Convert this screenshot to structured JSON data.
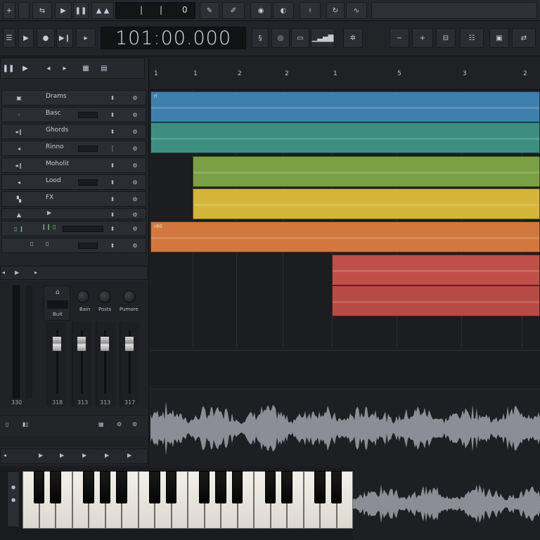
{
  "top_toolbar": {
    "position_marks": [
      "|",
      "|",
      "0"
    ],
    "icons": [
      "add-track-icon",
      "select-tool-icon",
      "play-icon",
      "pause-icon",
      "nudge-up-icon",
      "nudge-up-icon",
      "pencil-icon",
      "brush-icon",
      "monitor-icon",
      "input-icon",
      "tuning-fork-icon",
      "loop-icon",
      "metronome-icon"
    ]
  },
  "transport": {
    "time": "101:00.000"
  },
  "ruler": {
    "numbers": [
      "1",
      "1",
      "2",
      "2",
      "1",
      "5",
      "3",
      "2"
    ]
  },
  "tracks": [
    {
      "name": "Drams",
      "icon": "drum-icon"
    },
    {
      "name": "Basc",
      "icon": "bass-icon"
    },
    {
      "name": "Ghords",
      "icon": "speaker-icon"
    },
    {
      "name": "Rinno",
      "icon": "speaker-icon"
    },
    {
      "name": "Moholit",
      "icon": "speaker-icon"
    },
    {
      "name": "Lood",
      "icon": "speaker-icon"
    },
    {
      "name": "FX",
      "icon": "fx-icon"
    },
    {
      "name": "",
      "icon": "speaker-icon"
    },
    {
      "name": "",
      "icon": "midi-icon"
    },
    {
      "name": "",
      "icon": "instrument-icon"
    }
  ],
  "clips": [
    {
      "color": "#3f7fae",
      "label": "rl"
    },
    {
      "color": "#3d8e80",
      "label": ""
    },
    {
      "color": "#7aa045",
      "label": ""
    },
    {
      "color": "#d4b53a",
      "label": ""
    },
    {
      "color": "#d2783e",
      "label": "r80"
    },
    {
      "color": "#bf4f48",
      "label": ""
    },
    {
      "color": "#b84a45",
      "label": ""
    }
  ],
  "mixer": {
    "insert_label": "Buit",
    "knob_labels": [
      "Bain",
      "Posts",
      "Pumore"
    ],
    "strip_values": [
      "330",
      "318",
      "313",
      "313",
      "317"
    ]
  }
}
